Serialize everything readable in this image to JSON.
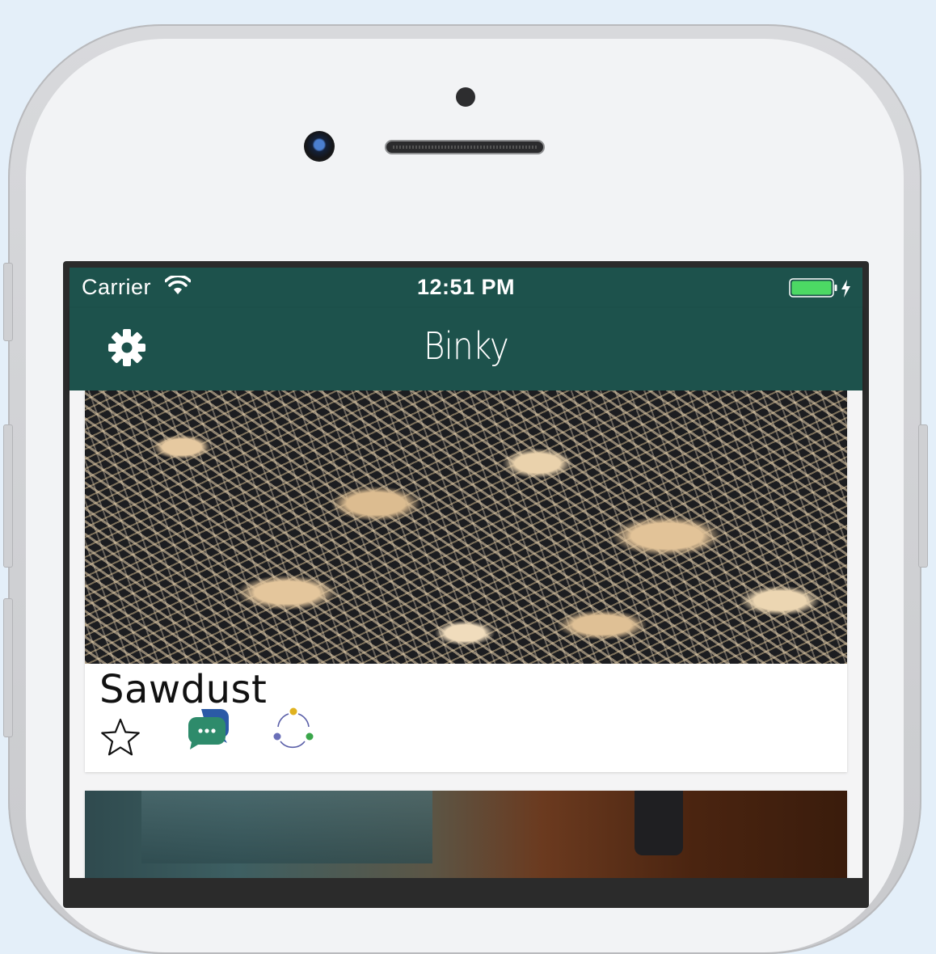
{
  "status_bar": {
    "carrier": "Carrier",
    "time": "12:51 PM",
    "battery_color": "#4cd964"
  },
  "nav_bar": {
    "title": "Binky",
    "background": "#1d524c",
    "left_icon": "gear-icon"
  },
  "feed": {
    "items": [
      {
        "title": "Sawdust",
        "image": "sawdust-photo",
        "actions": [
          "star-icon",
          "chat-bubbles-icon",
          "share-circle-icon"
        ]
      },
      {
        "title": "",
        "image": "food-photo"
      }
    ]
  }
}
